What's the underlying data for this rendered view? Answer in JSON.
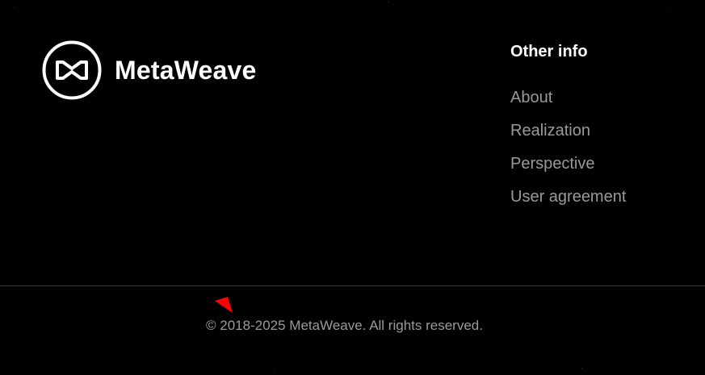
{
  "brand": {
    "name": "MetaWeave",
    "logo_icon": "bowtie-loop-logo-icon"
  },
  "other_info": {
    "heading": "Other info",
    "links": [
      {
        "label": "About"
      },
      {
        "label": "Realization"
      },
      {
        "label": "Perspective"
      },
      {
        "label": "User agreement"
      }
    ]
  },
  "copyright": {
    "text": "© 2018-2025 MetaWeave. All rights reserved."
  },
  "cursor": {
    "icon": "red-arrow-cursor-icon",
    "color": "#ff0000"
  },
  "colors": {
    "background": "#000000",
    "primary_text": "#ffffff",
    "muted_text": "#9a9a9a",
    "divider": "#3a3a3a"
  }
}
